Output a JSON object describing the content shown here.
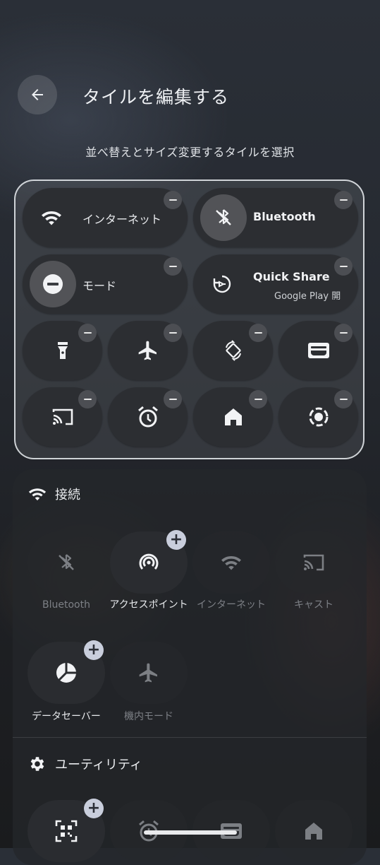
{
  "header": {
    "title": "タイルを編集する",
    "subtitle": "並べ替えとサイズ変更するタイルを選択"
  },
  "active_tiles": {
    "internet": "インターネット",
    "bluetooth": "Bluetooth",
    "mode": "モード",
    "quick_share": "Quick Share",
    "quick_share_sub": "Google Play 開"
  },
  "available": {
    "connection_section": "接続",
    "bluetooth": "Bluetooth",
    "hotspot": "アクセスポイント",
    "internet": "インターネット",
    "cast": "キャスト",
    "data_saver": "データセーバー",
    "airplane": "機内モード",
    "utility_section": "ユーティリティ"
  }
}
